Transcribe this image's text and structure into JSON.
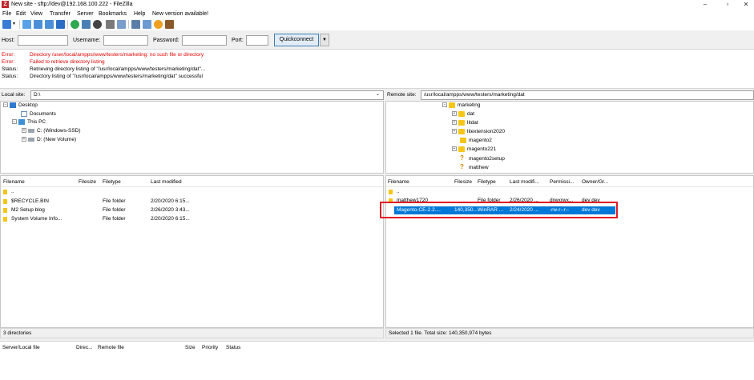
{
  "window": {
    "title": "New site - sftp://dev@192.168.100.222 - FileZilla",
    "app_icon_letter": "Z",
    "controls": [
      "–",
      "▫",
      "✕"
    ]
  },
  "menu": [
    "File",
    "Edit",
    "View",
    "Transfer",
    "Server",
    "Bookmarks",
    "Help",
    "New version available!"
  ],
  "toolbar": {
    "icons": [
      "site-manager-icon",
      "toggle-log-icon",
      "toggle-local-tree-icon",
      "toggle-remote-tree-icon",
      "toggle-queue-icon",
      "refresh-icon",
      "process-queue-icon",
      "cancel-icon",
      "disconnect-icon",
      "reconnect-icon",
      "filter-icon",
      "compare-icon",
      "sync-browse-icon",
      "search-icon"
    ]
  },
  "quickconnect": {
    "host_label": "Host:",
    "host_value": "",
    "username_label": "Username:",
    "username_value": "",
    "password_label": "Password:",
    "password_value": "",
    "port_label": "Port:",
    "port_value": "",
    "button_label": "Quickconnect",
    "dropdown_arrow": "▼"
  },
  "log": [
    {
      "type": "Error:",
      "message": "Directory /user/local/ampps/www/testers/marketing: no such file or directory",
      "level": "error"
    },
    {
      "type": "Error:",
      "message": "Failed to retrieve directory listing",
      "level": "error"
    },
    {
      "type": "Status:",
      "message": "Retrieving directory listing of \"/usr/local/ampps/www/testers/marketing/dat\"...",
      "level": "status"
    },
    {
      "type": "Status:",
      "message": "Directory listing of \"/usr/local/ampps/www/testers/marketing/dat\" successful",
      "level": "status"
    }
  ],
  "local": {
    "site_label": "Local site:",
    "path": "D:\\",
    "tree": [
      {
        "label": "Desktop",
        "icon": "desktop-icon",
        "expander": "−"
      },
      {
        "label": "Documents",
        "icon": "documents-icon",
        "expander": ""
      },
      {
        "label": "This PC",
        "icon": "this-pc-icon",
        "expander": "−"
      },
      {
        "label": "C: (Windows-SSD)",
        "icon": "drive-icon",
        "expander": "+"
      },
      {
        "label": "D: (New Volume)",
        "icon": "drive-icon",
        "expander": "+"
      }
    ],
    "columns": [
      "Filename",
      "Filesize",
      "Filetype",
      "Last modified"
    ],
    "files": [
      {
        "name": "..",
        "size": "",
        "type": "",
        "modified": ""
      },
      {
        "name": "$RECYCLE.BIN",
        "size": "",
        "type": "File folder",
        "modified": "2/20/2020 6:15..."
      },
      {
        "name": "M2 Setup blog",
        "size": "",
        "type": "File folder",
        "modified": "2/26/2020 3:43..."
      },
      {
        "name": "System Volume Info...",
        "size": "",
        "type": "File folder",
        "modified": "2/20/2020 6:15..."
      }
    ],
    "status": "3 directories"
  },
  "remote": {
    "site_label": "Remote site:",
    "path": "/usr/local/ampps/www/testers/marketing/dat",
    "tree": [
      {
        "label": "marketing",
        "icon": "folder-icon",
        "expander": "−"
      },
      {
        "label": "dat",
        "icon": "folder-icon",
        "expander": "+"
      },
      {
        "label": "litdat",
        "icon": "folder-icon",
        "expander": "+"
      },
      {
        "label": "litextension2020",
        "icon": "folder-icon",
        "expander": "+"
      },
      {
        "label": "magento2",
        "icon": "folder-icon",
        "expander": ""
      },
      {
        "label": "magento221",
        "icon": "folder-icon",
        "expander": "+"
      },
      {
        "label": "magento2setup",
        "icon": "unknown-icon",
        "expander": ""
      },
      {
        "label": "matthew",
        "icon": "unknown-icon",
        "expander": ""
      }
    ],
    "columns": [
      "Filename",
      "Filesize",
      "Filetype",
      "Last modifi...",
      "Permissi...",
      "Owner/Gr..."
    ],
    "files": [
      {
        "name": "..",
        "size": "",
        "type": "",
        "modified": "",
        "perms": "",
        "owner": ""
      },
      {
        "name": "matthew1720",
        "size": "",
        "type": "File folder",
        "modified": "2/26/2020 ...",
        "perms": "drwxrwx...",
        "owner": "dev dev"
      },
      {
        "name": "Magento-CE-2.2....",
        "size": "140,350...",
        "type": "WinRAR ...",
        "modified": "2/24/2020 ...",
        "perms": "-rw-r--r--",
        "owner": "dev dev"
      }
    ],
    "status": "Selected 1 file. Total size: 140,350,974 bytes"
  },
  "queue": {
    "columns": [
      "Server/Local file",
      "Direc...",
      "Remote file",
      "Size",
      "Priority",
      "Status"
    ]
  },
  "colors": {
    "error_text": "#e00000",
    "selection": "#0078d7",
    "highlight_box": "#e31b23",
    "folder": "#f5c518"
  }
}
